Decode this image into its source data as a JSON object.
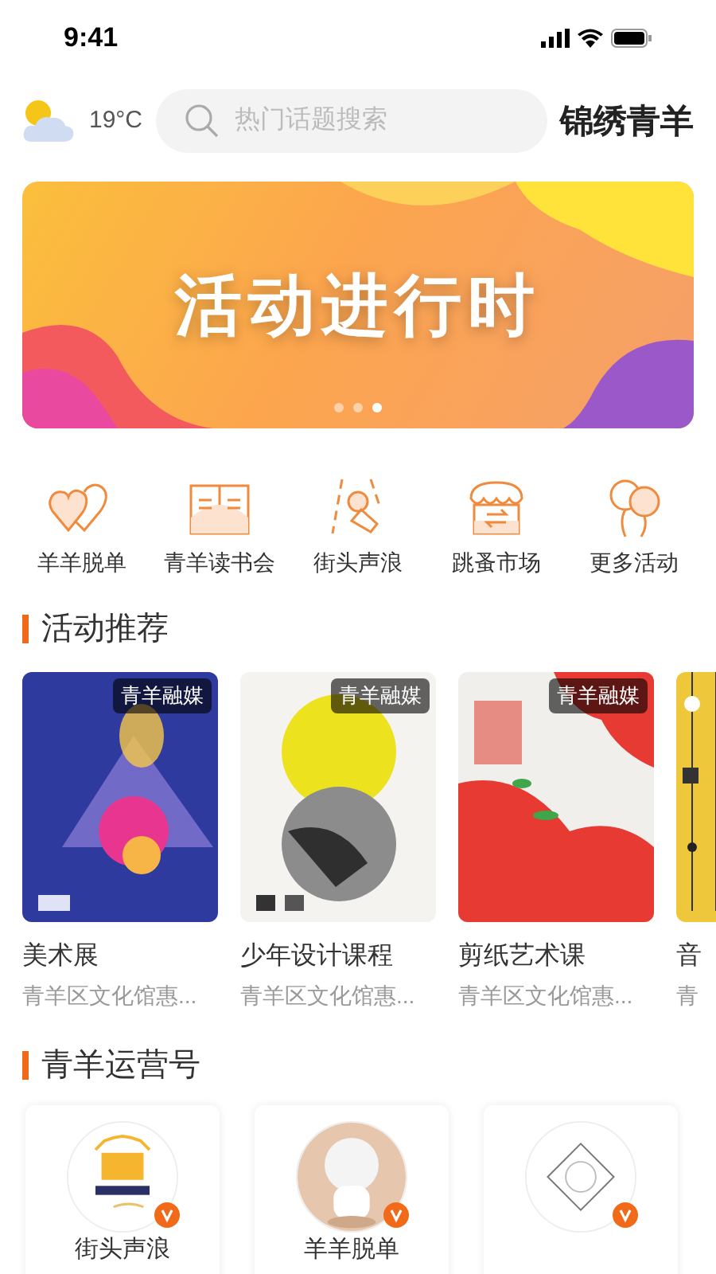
{
  "status_bar": {
    "time": "9:41"
  },
  "header": {
    "temperature": "19°C",
    "search": {
      "placeholder": "热门话题搜索"
    },
    "brand": "锦绣青羊"
  },
  "banner": {
    "title": "活动进行时",
    "dots": [
      {
        "selected": false
      },
      {
        "selected": false
      },
      {
        "selected": true
      }
    ]
  },
  "shortcuts": [
    {
      "label": "羊羊脱单",
      "kind": "hearts"
    },
    {
      "label": "青羊读书会",
      "kind": "book"
    },
    {
      "label": "街头声浪",
      "kind": "mic"
    },
    {
      "label": "跳蚤市场",
      "kind": "store"
    },
    {
      "label": "更多活动",
      "kind": "balloons"
    }
  ],
  "activities": {
    "title": "活动推荐",
    "items": [
      {
        "title": "美术展",
        "subtitle": "青羊区文化馆惠...",
        "badge": "青羊融媒",
        "kind": "picture"
      },
      {
        "title": "少年设计课程",
        "subtitle": "青羊区文化馆惠...",
        "badge": "青羊融媒",
        "kind": "picture"
      },
      {
        "title": "剪纸艺术课",
        "subtitle": "青羊区文化馆惠...",
        "badge": "青羊融媒",
        "kind": "picture"
      },
      {
        "title": "音",
        "subtitle": "青",
        "kind": "picture"
      }
    ]
  },
  "accounts": {
    "title": "青羊运营号",
    "items": [
      {
        "name": "街头声浪",
        "verified": true
      },
      {
        "name": "羊羊脱单",
        "verified": true
      },
      {
        "verified": true
      }
    ]
  }
}
